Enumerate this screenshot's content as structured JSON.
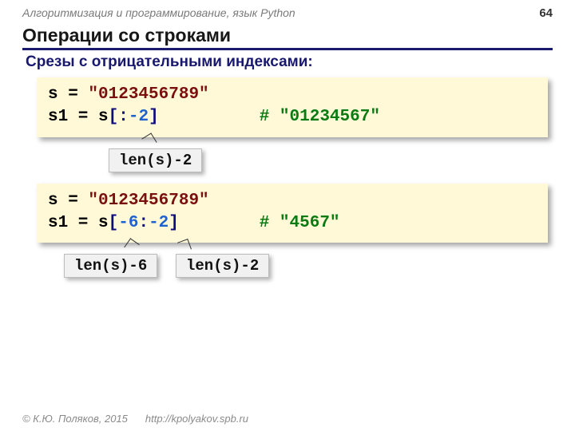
{
  "header": {
    "course": "Алгоритмизация и программирование, язык Python",
    "page": "64"
  },
  "title": "Операции со строками",
  "subtitle": "Срезы с отрицательными индексами:",
  "block1": {
    "assign_var": "s = ",
    "assign_str": "\"0123456789\"",
    "slice_pre": "s1 = s",
    "slice_open": "[",
    "slice_mid1": ":",
    "slice_neg1": "-2",
    "slice_close": "]",
    "pad": "          ",
    "comment": "# \"01234567\""
  },
  "annot1": {
    "a": "len(s)-2"
  },
  "block2": {
    "assign_var": "s = ",
    "assign_str": "\"0123456789\"",
    "slice_pre": "s1 = s",
    "slice_open": "[",
    "slice_neg1": "-6",
    "slice_mid1": ":",
    "slice_neg2": "-2",
    "slice_close": "]",
    "pad": "        ",
    "comment": "# \"4567\""
  },
  "annot2": {
    "a": "len(s)-6",
    "b": "len(s)-2"
  },
  "footer": {
    "copyright": "© К.Ю. Поляков, 2015",
    "url": "http://kpolyakov.spb.ru"
  }
}
